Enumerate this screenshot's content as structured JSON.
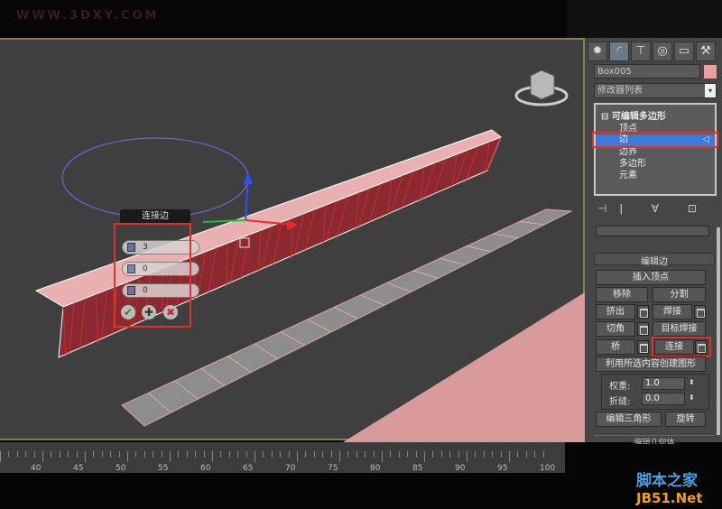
{
  "watermark": "WWW.3DXY.COM",
  "viewport": {
    "caddy": {
      "title": "连接边",
      "segments": "3",
      "pinch": "0",
      "slide": "0",
      "ok": "✔",
      "apply": "✚",
      "cancel": "✖"
    }
  },
  "panel": {
    "tabs": [
      "create-icon",
      "modify-icon",
      "hierarchy-icon",
      "motion-icon",
      "display-icon",
      "utilities-icon"
    ],
    "object_name": "Box005",
    "object_color": "#e8a0a0",
    "modifier_list": "修改器列表",
    "stack": {
      "root": "可编辑多边形",
      "items": [
        "顶点",
        "边",
        "边界",
        "多边形",
        "元素"
      ],
      "selected": "边"
    },
    "rollout_title": "编辑边",
    "buttons": {
      "insert_vertex": "插入顶点",
      "remove": "移除",
      "split": "分割",
      "extrude": "挤出",
      "weld": "焊接",
      "chamfer": "切角",
      "target_weld": "目标焊接",
      "bridge": "桥",
      "connect": "连接",
      "create_shape": "利用所选内容创建图形",
      "edit_tri": "编辑三角形",
      "turn": "旋转"
    },
    "weight_label": "权重:",
    "weight": "1.0",
    "crease_label": "折缝:",
    "crease": "0.0",
    "next_rollout": "编辑几何体"
  },
  "timeline": {
    "labels": [
      "40",
      "45",
      "50",
      "55",
      "60",
      "65",
      "70",
      "75",
      "80",
      "85",
      "90",
      "95",
      "100"
    ]
  },
  "logo": {
    "line1": "脚本之家",
    "line2": "JB51.Net"
  }
}
